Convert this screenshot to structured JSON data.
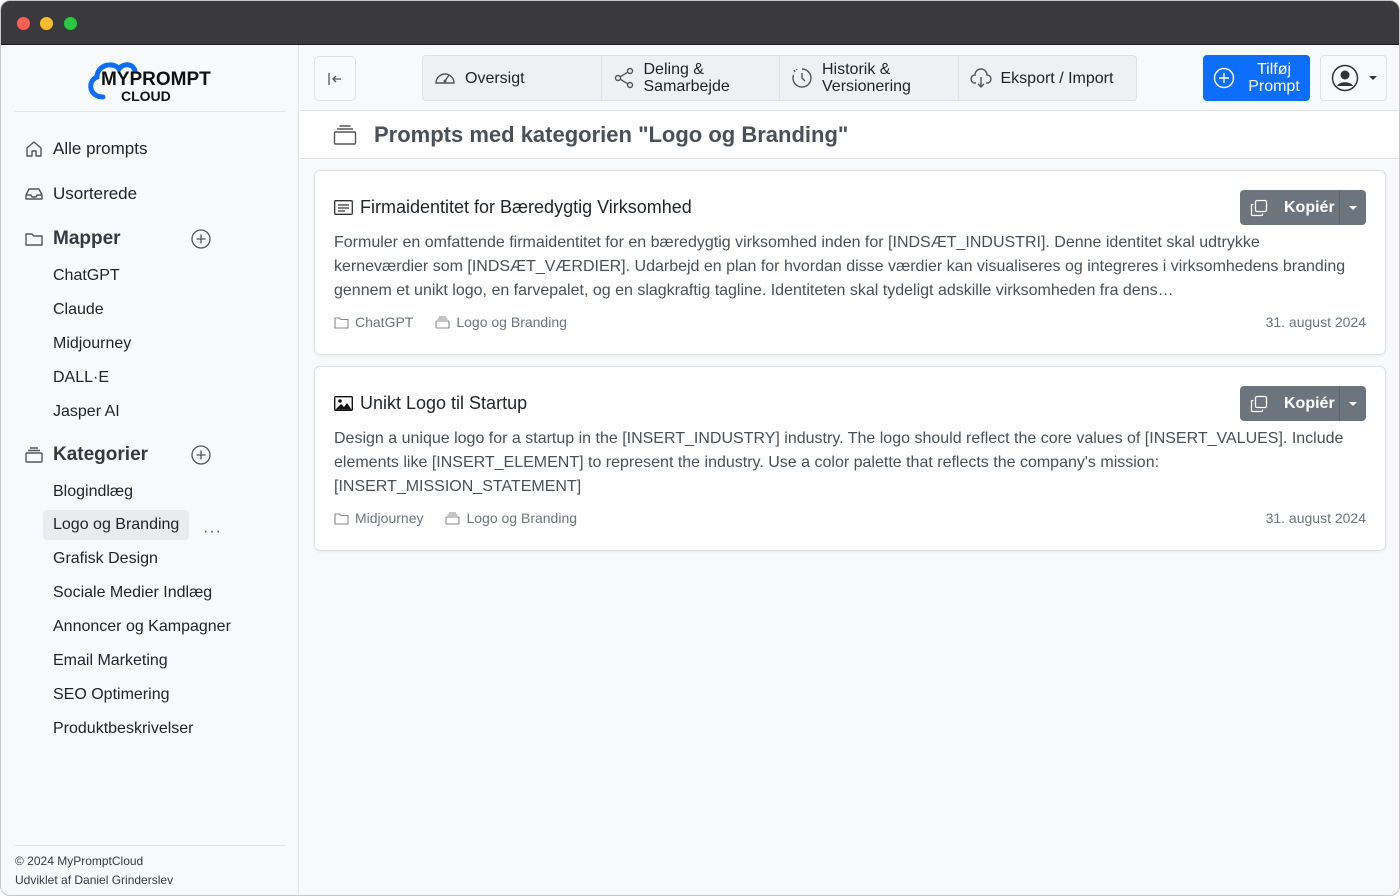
{
  "logo": {
    "line1": "MYPROMPT",
    "line2": "CLOUD"
  },
  "sidebar": {
    "all_prompts": "Alle prompts",
    "unsorted": "Usorterede",
    "folders_title": "Mapper",
    "folders": [
      "ChatGPT",
      "Claude",
      "Midjourney",
      "DALL·E",
      "Jasper AI"
    ],
    "categories_title": "Kategorier",
    "categories": [
      "Blogindlæg",
      "Logo og Branding",
      "Grafisk Design",
      "Sociale Medier Indlæg",
      "Annoncer og Kampagner",
      "Email Marketing",
      "SEO Optimering",
      "Produktbeskrivelser"
    ],
    "active_category": "Logo og Branding",
    "more": "···",
    "footer_line1": "© 2024 MyPromptCloud",
    "footer_line2": "Udviklet af Daniel Grinderslev"
  },
  "topbar": {
    "nav": [
      {
        "label": "Oversigt",
        "icon": "speedometer-icon"
      },
      {
        "label": "Deling & Samarbejde",
        "icon": "share-icon"
      },
      {
        "label": "Historik & Versionering",
        "icon": "history-icon"
      },
      {
        "label": "Eksport / Import",
        "icon": "cloud-download-icon"
      }
    ],
    "add_button": "Tilføj Prompt"
  },
  "page": {
    "title": "Prompts med kategorien \"Logo og Branding\""
  },
  "prompts": [
    {
      "title": "Firmaidentitet for Bæredygtig Virksomhed",
      "icon": "text-document-icon",
      "text": "Formuler en omfattende firmaidentitet for en bæredygtig virksomhed inden for [INDSÆT_INDUSTRI]. Denne identitet skal udtrykke kerneværdier som [INDSÆT_VÆRDIER]. Udarbejd en plan for hvordan disse værdier kan visualiseres og integreres i virksomhedens branding gennem et unikt logo, en farvepalet, og en slagkraftig tagline. Identiteten skal tydeligt adskille virksomheden fra dens…",
      "folder": "ChatGPT",
      "category": "Logo og Branding",
      "date": "31. august 2024",
      "copy_label": "Kopiér"
    },
    {
      "title": "Unikt Logo til Startup",
      "icon": "image-icon",
      "text": "Design a unique logo for a startup in the [INSERT_INDUSTRY] industry. The logo should reflect the core values of [INSERT_VALUES]. Include elements like [INSERT_ELEMENT] to represent the industry. Use a color palette that reflects the company's mission: [INSERT_MISSION_STATEMENT]",
      "folder": "Midjourney",
      "category": "Logo og Branding",
      "date": "31. august 2024",
      "copy_label": "Kopiér"
    }
  ],
  "colors": {
    "primary": "#0d6efd",
    "secondary": "#6c757d",
    "sidebar_bg": "#f8f9fa",
    "active_item_bg": "#e9ecef"
  }
}
